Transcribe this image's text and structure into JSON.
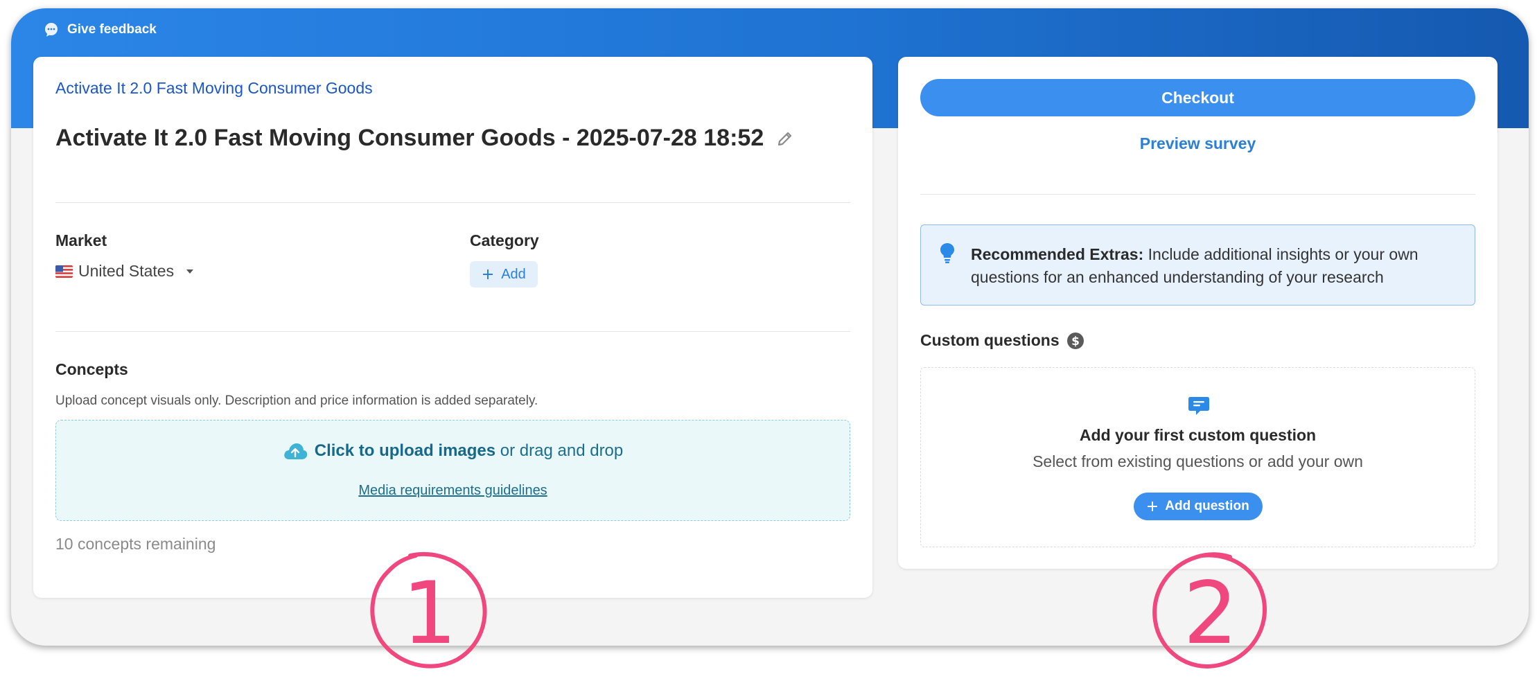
{
  "header": {
    "feedback_label": "Give feedback"
  },
  "project": {
    "breadcrumb": "Activate It 2.0 Fast Moving Consumer Goods",
    "title": "Activate It 2.0 Fast Moving Consumer Goods - 2025-07-28 18:52"
  },
  "market": {
    "label": "Market",
    "value": "United States"
  },
  "category": {
    "label": "Category",
    "add_label": "Add"
  },
  "concepts": {
    "label": "Concepts",
    "description": "Upload concept visuals only. Description and price information is added separately.",
    "upload_bold": "Click to upload images",
    "upload_rest": " or drag and drop",
    "media_link": "Media requirements guidelines",
    "remaining": "10 concepts remaining"
  },
  "sidebar": {
    "checkout_label": "Checkout",
    "preview_label": "Preview survey",
    "extras_bold": "Recommended Extras:",
    "extras_text": " Include additional insights or your own questions for an enhanced understanding of your research",
    "custom_questions_label": "Custom questions",
    "empty_title": "Add your first custom question",
    "empty_sub": "Select from existing questions or add your own",
    "add_question_label": "Add question"
  },
  "annotations": [
    "1",
    "2"
  ],
  "colors": {
    "brand_blue": "#3b8fef",
    "banner_start": "#2b86e8",
    "banner_end": "#1559b0",
    "link_blue": "#1a56c9",
    "annotation_pink": "#f0477f"
  }
}
